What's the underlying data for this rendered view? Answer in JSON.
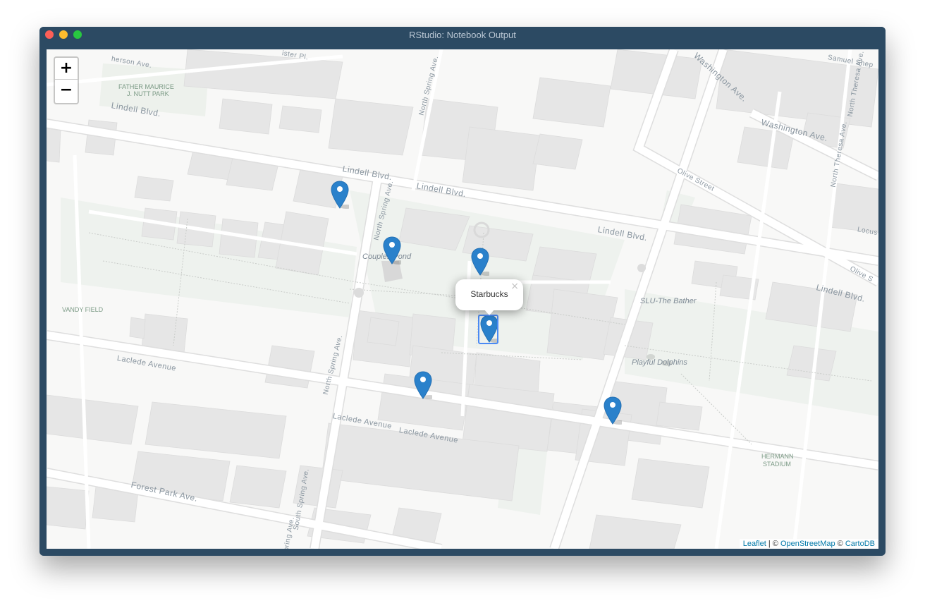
{
  "window": {
    "title": "RStudio: Notebook Output",
    "controls": [
      "close",
      "minimize",
      "maximize"
    ]
  },
  "zoom": {
    "in_label": "+",
    "out_label": "−"
  },
  "popup": {
    "text": "Starbucks",
    "close_label": "×"
  },
  "markers": [
    {
      "icon": "map-marker-icon",
      "color": "#2a81cb"
    },
    {
      "icon": "map-marker-icon",
      "color": "#2a81cb"
    },
    {
      "icon": "map-marker-icon",
      "color": "#2a81cb"
    },
    {
      "icon": "map-marker-icon",
      "color": "#2a81cb"
    },
    {
      "icon": "map-marker-icon",
      "color": "#2a81cb"
    },
    {
      "icon": "map-marker-icon",
      "color": "#2a81cb"
    }
  ],
  "map_labels": {
    "father_maurice": "FATHER MAURICE",
    "nutt_park": "J. NUTT PARK",
    "vandy_field": "VANDY FIELD",
    "hermann_1": "HERMANN",
    "hermann_2": "STADIUM",
    "couples_pond": "Couples Pond",
    "slu_bather": "SLU-The Bather",
    "playful_dolphins": "Playful Dolphins",
    "lindell_1": "Lindell Blvd.",
    "lindell_2": "Lindell Blvd.",
    "lindell_3": "Lindell Blvd.",
    "lindell_4": "Lindell Blvd.",
    "lindell_5": "Lindell Blvd.",
    "washington": "Washington Ave.",
    "washington_top": "Washington Ave.",
    "olive_1": "Olive Street",
    "olive_2": "Olive S",
    "north_spring_1": "North Spring Ave.",
    "north_spring_2": "North Spring Ave.",
    "north_spring_3": "North Spring Ave.",
    "south_spring": "South Spring Ave.",
    "spring_ave": "pring Ave.",
    "laclede_1": "Laclede Avenue",
    "laclede_2": "Laclede Avenue",
    "laclede_3": "Laclede Avenue",
    "forest_park": "Forest Park Ave.",
    "samuel": "Samuel Shep",
    "north_theresa_1": "North Theresa Ave.",
    "north_theresa_2": "North Theresa Ave.",
    "locust": "Locus",
    "herson": "herson Ave.",
    "lister": "ister Pl."
  },
  "attribution": {
    "leaflet": "Leaflet",
    "sep1": " | © ",
    "osm": "OpenStreetMap",
    "sep2": " © ",
    "carto": "CartoDB"
  }
}
